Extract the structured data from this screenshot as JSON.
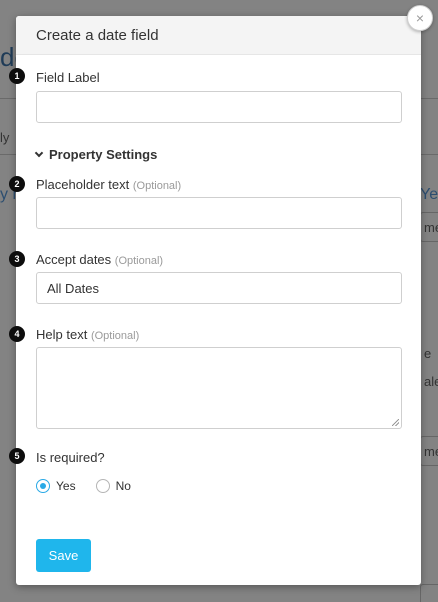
{
  "background": {
    "fragment_de": "de",
    "fragment_ly": "ly",
    "fragment_y": "y n",
    "fragment_ye": "Ye",
    "fragment_me_1": "me",
    "fragment_e": "e",
    "fragment_ale": "ale",
    "fragment_me_2": "me"
  },
  "modal": {
    "title": "Create a date field",
    "close_glyph": "×",
    "fields": {
      "field_label": {
        "step": "1",
        "label": "Field Label",
        "value": "",
        "placeholder": ""
      },
      "property_settings": {
        "label": "Property Settings",
        "expanded": true
      },
      "placeholder_text": {
        "step": "2",
        "label": "Placeholder text",
        "optional": "(Optional)",
        "value": ""
      },
      "accept_dates": {
        "step": "3",
        "label": "Accept dates",
        "optional": "(Optional)",
        "value": "All Dates"
      },
      "help_text": {
        "step": "4",
        "label": "Help text",
        "optional": "(Optional)",
        "value": ""
      },
      "is_required": {
        "step": "5",
        "label": "Is required?",
        "options": [
          {
            "label": "Yes",
            "checked": true
          },
          {
            "label": "No",
            "checked": false
          }
        ]
      }
    },
    "save_label": "Save"
  },
  "colors": {
    "accent": "#1fb6ec",
    "radio_accent": "#29a9e6",
    "overlay": "#838383"
  },
  "icons": {
    "close": "close-icon",
    "chevron": "chevron-down-icon"
  }
}
